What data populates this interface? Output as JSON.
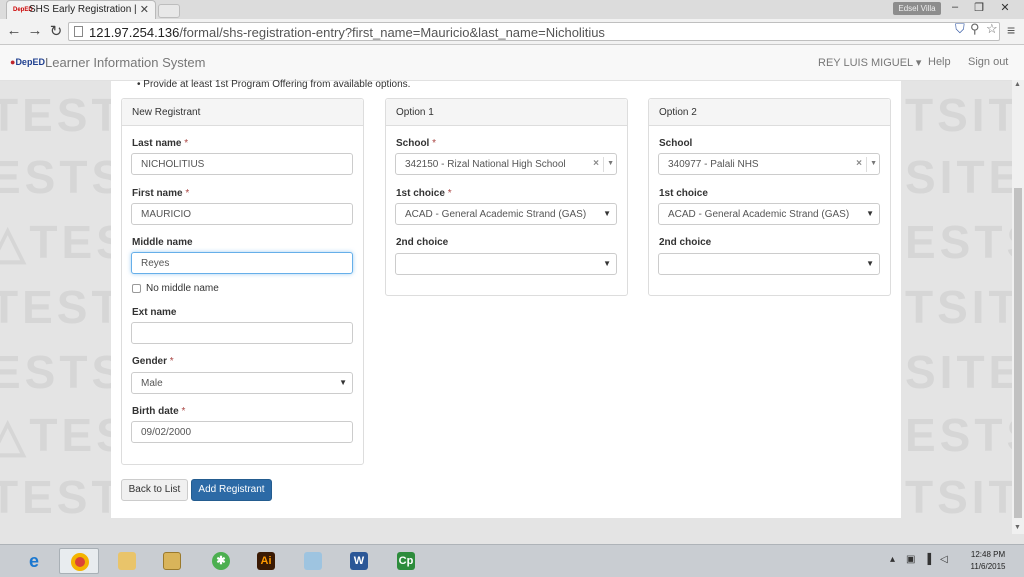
{
  "browser": {
    "tab_title": "SHS Early Registration | Le",
    "tab_close": "✕",
    "profile_label": "Edsel Villa",
    "url_host": "121.97.254.136",
    "url_path": "/formal/shs-registration-entry?first_name=Mauricio&last_name=Nicholitius"
  },
  "app": {
    "logo_text": "DepED",
    "brand": "Learner Information System",
    "user_menu": "REY LUIS MIGUEL",
    "help": "Help",
    "signout": "Sign out"
  },
  "watermark": "TEST",
  "instruction": "Provide at least 1st Program Offering from available options.",
  "registrant": {
    "title": "New Registrant",
    "last_name_label": "Last name",
    "last_name": "NICHOLITIUS",
    "first_name_label": "First name",
    "first_name": "MAURICIO",
    "middle_name_label": "Middle name",
    "middle_name": "Reyes",
    "no_middle_label": "No middle name",
    "ext_name_label": "Ext name",
    "ext_name": "",
    "gender_label": "Gender",
    "gender": "Male",
    "birth_label": "Birth date",
    "birth_date": "09/02/2000",
    "required_mark": "*"
  },
  "option1": {
    "title": "Option 1",
    "school_label": "School",
    "school": "342150 - Rizal National High School",
    "first_choice_label": "1st choice",
    "first_choice": "ACAD - General Academic Strand (GAS)",
    "second_choice_label": "2nd choice",
    "second_choice": ""
  },
  "option2": {
    "title": "Option 2",
    "school_label": "School",
    "school": "340977 - Palali NHS",
    "first_choice_label": "1st choice",
    "first_choice": "ACAD - General Academic Strand (GAS)",
    "second_choice_label": "2nd choice",
    "second_choice": ""
  },
  "buttons": {
    "back": "Back to List",
    "add": "Add Registrant"
  },
  "taskbar": {
    "time": "12:48 PM",
    "date": "11/6/2015"
  }
}
